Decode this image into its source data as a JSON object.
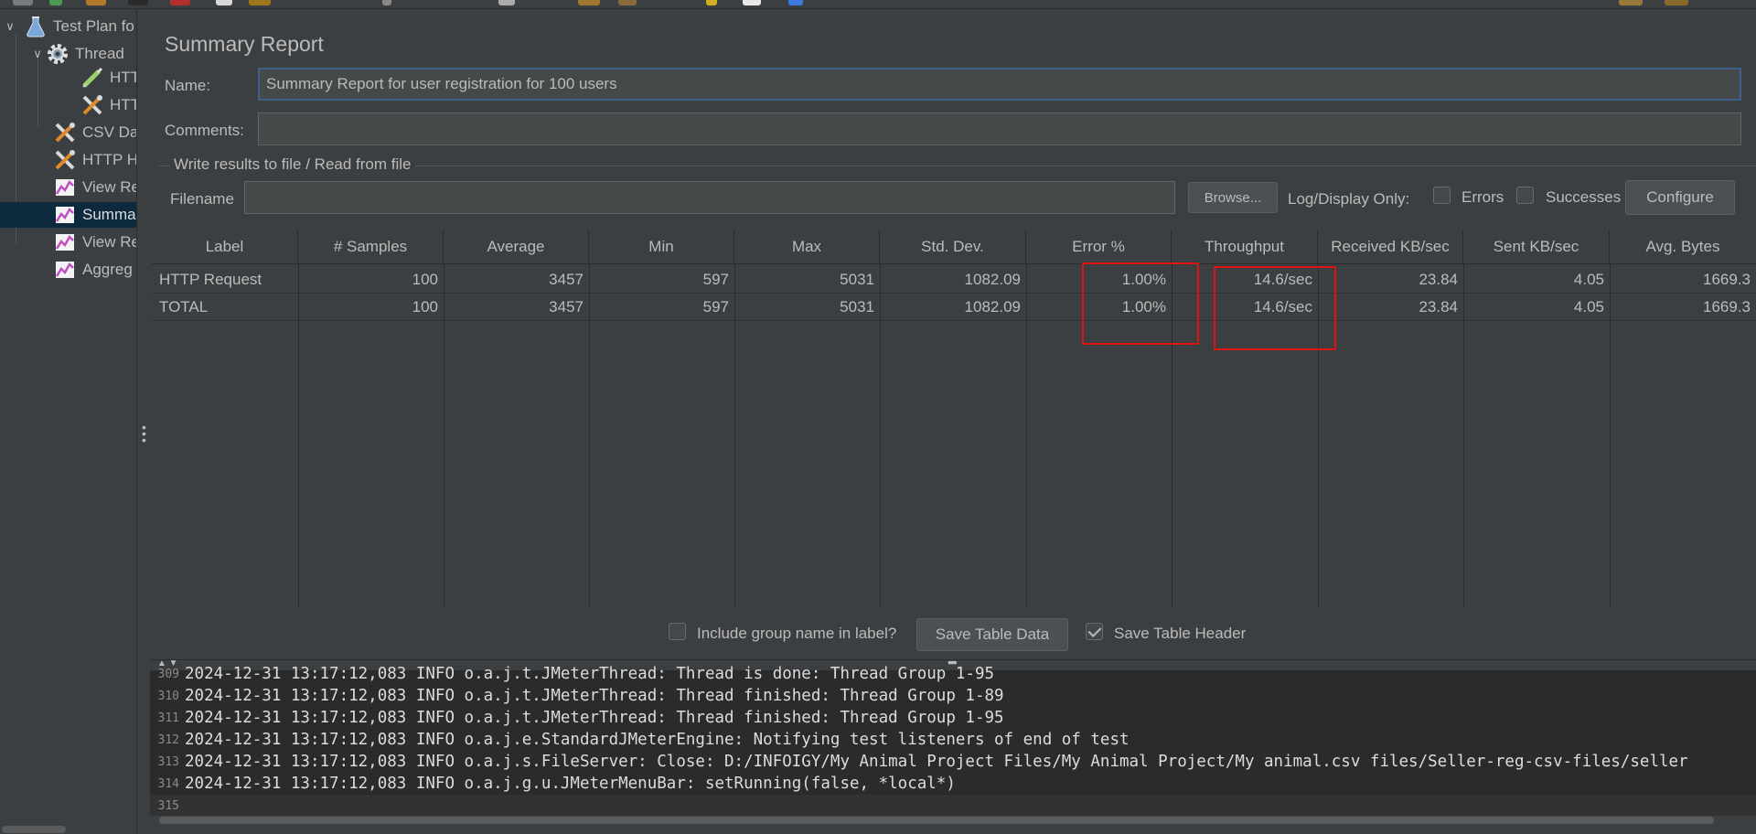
{
  "tree": {
    "items": [
      {
        "label": "Test Plan fo",
        "icon": "flask-icon"
      },
      {
        "label": "Thread",
        "icon": "gear-icon"
      },
      {
        "label": "HTT",
        "icon": "pipette-icon"
      },
      {
        "label": "HTT",
        "icon": "tools-icon"
      },
      {
        "label": "CSV Da",
        "icon": "tools-icon"
      },
      {
        "label": "HTTP H",
        "icon": "tools-icon"
      },
      {
        "label": "View Re",
        "icon": "graph-icon"
      },
      {
        "label": "Summa",
        "icon": "graph-icon"
      },
      {
        "label": "View Re",
        "icon": "graph-icon"
      },
      {
        "label": "Aggreg",
        "icon": "graph-icon"
      }
    ]
  },
  "panel": {
    "title": "Summary Report",
    "name_label": "Name:",
    "name_value": "Summary Report for user registration for 100 users",
    "comments_label": "Comments:",
    "comments_value": "",
    "file_group_title": "Write results to file / Read from file",
    "filename_label": "Filename",
    "filename_value": "",
    "browse_label": "Browse...",
    "log_display_label": "Log/Display Only:",
    "errors_label": "Errors",
    "successes_label": "Successes",
    "configure_label": "Configure"
  },
  "table": {
    "headers": [
      "Label",
      "# Samples",
      "Average",
      "Min",
      "Max",
      "Std. Dev.",
      "Error %",
      "Throughput",
      "Received KB/sec",
      "Sent KB/sec",
      "Avg. Bytes"
    ],
    "rows": [
      [
        "HTTP Request",
        "100",
        "3457",
        "597",
        "5031",
        "1082.09",
        "1.00%",
        "14.6/sec",
        "23.84",
        "4.05",
        "1669.3"
      ],
      [
        "TOTAL",
        "100",
        "3457",
        "597",
        "5031",
        "1082.09",
        "1.00%",
        "14.6/sec",
        "23.84",
        "4.05",
        "1669.3"
      ]
    ]
  },
  "bottom": {
    "include_group_label": "Include group name in label?",
    "include_group_checked": false,
    "save_table_data_label": "Save Table Data",
    "save_table_header_label": "Save Table Header",
    "save_table_header_checked": true
  },
  "log": {
    "lines": [
      {
        "num": "309",
        "text": "2024-12-31 13:17:12,083 INFO o.a.j.t.JMeterThread: Thread is done: Thread Group 1-95"
      },
      {
        "num": "310",
        "text": "2024-12-31 13:17:12,083 INFO o.a.j.t.JMeterThread: Thread finished: Thread Group 1-89"
      },
      {
        "num": "311",
        "text": "2024-12-31 13:17:12,083 INFO o.a.j.t.JMeterThread: Thread finished: Thread Group 1-95"
      },
      {
        "num": "312",
        "text": "2024-12-31 13:17:12,083 INFO o.a.j.e.StandardJMeterEngine: Notifying test listeners of end of test"
      },
      {
        "num": "313",
        "text": "2024-12-31 13:17:12,083 INFO o.a.j.s.FileServer: Close: D:/INFOIGY/My Animal Project Files/My Animal Project/My animal.csv files/Seller-reg-csv-files/seller"
      },
      {
        "num": "314",
        "text": "2024-12-31 13:17:12,083 INFO o.a.j.g.u.JMeterMenuBar: setRunning(false, *local*)"
      },
      {
        "num": "315",
        "text": ""
      }
    ]
  },
  "colors": {
    "background": "#3c3f41",
    "log_background": "#2b2b2b",
    "highlight": "#e01313",
    "selection": "#0d293e",
    "focus_border": "#3d6185"
  }
}
